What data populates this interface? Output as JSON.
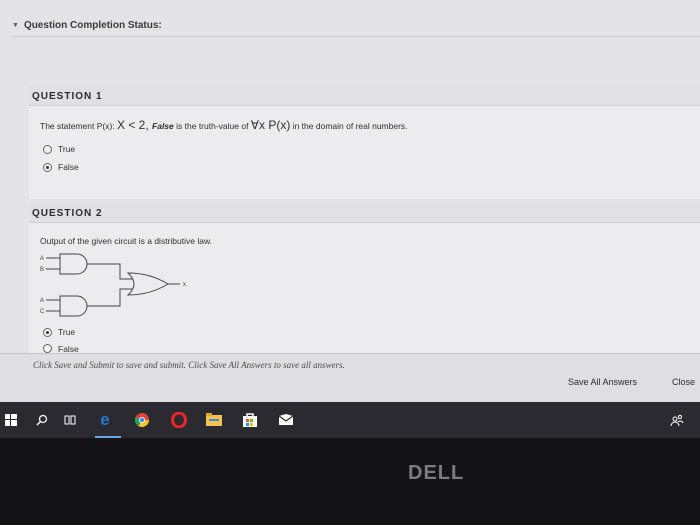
{
  "status": {
    "title": "Question Completion Status:"
  },
  "question1": {
    "header": "QUESTION 1",
    "text_a": "The statement P(x): ",
    "text_b": "X < 2, ",
    "text_c": "False",
    "text_d": " is the truth-value of ",
    "text_e": "∀x P(x)",
    "text_f": " in the domain of real numbers.",
    "options": [
      {
        "label": "True",
        "selected": false
      },
      {
        "label": "False",
        "selected": true
      }
    ]
  },
  "question2": {
    "header": "QUESTION 2",
    "text": "Output of the given circuit is a distributive law.",
    "circuit_labels": {
      "a1": "A",
      "b": "B",
      "a2": "A",
      "c": "C",
      "out": "x"
    },
    "options": [
      {
        "label": "True",
        "selected": true
      },
      {
        "label": "False",
        "selected": false
      }
    ]
  },
  "footer": {
    "note": "Click Save and Submit to save and submit. Click Save All Answers to save all answers.",
    "save_all": "Save All Answers",
    "close": "Close"
  },
  "taskbar": {
    "icons": [
      "windows-icon",
      "search-icon",
      "task-view-icon",
      "edge-icon",
      "chrome-icon",
      "opera-icon",
      "file-explorer-icon",
      "store-icon",
      "mail-icon",
      "people-icon"
    ]
  },
  "bezel": {
    "logo": "DELL"
  },
  "colors": {
    "screen_bg": "#e4e4e6",
    "taskbar": "#2a2a30",
    "edge_blue": "#1f7ad8",
    "opera_red": "#e8262b"
  }
}
